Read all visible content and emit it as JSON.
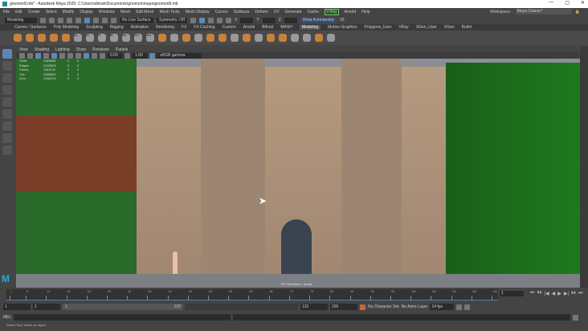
{
  "title": "gnomon8.mb* - Autodesk Maya 2020: C:\\Users\\dimak\\Documents\\gnomon\\maya\\gnomon8.mb",
  "window_controls": [
    "—",
    "▢",
    "✕"
  ],
  "menu": [
    "File",
    "Edit",
    "Create",
    "Select",
    "Modify",
    "Display",
    "Windows",
    "Mesh",
    "Edit Mesh",
    "Mesh Tools",
    "Mesh Display",
    "Curves",
    "Surfaces",
    "Deform",
    "UV",
    "Generate",
    "Cache",
    "V-Ray",
    "Arnold",
    "Help"
  ],
  "workspace": {
    "label": "Workspace :",
    "value": "Maya Classic*"
  },
  "status": {
    "mode": "Modeling",
    "live_surface": "No Live Surface",
    "symmetry": "Symmetry: Off",
    "x_label": "X",
    "y_label": "Y",
    "z_label": "Z",
    "user": "Dima Kremanskiy",
    "notifications": "29"
  },
  "shelf_tabs": [
    "Curves / Surfaces",
    "Poly Modeling",
    "Sculpting",
    "Rigging",
    "Animation",
    "Rendering",
    "FX",
    "FX Caching",
    "Custom",
    "Arnold",
    "Bifrost",
    "MASH",
    "Modeling",
    "Motion Graphics",
    "Polygons_User",
    "VRay",
    "XGen_User",
    "XGen",
    "Bullet"
  ],
  "active_shelf_tab": "Modeling",
  "shelf_labels": [
    "Mirr",
    "CP",
    "FT",
    "BP",
    "MIR",
    "MAT",
    "SUB"
  ],
  "panel_menu": [
    "View",
    "Shading",
    "Lighting",
    "Show",
    "Renderer",
    "Panels"
  ],
  "panel_toolbar": {
    "exposure": "0.00",
    "gamma": "1.00",
    "colorspace": "sRGB gamma"
  },
  "hud": [
    {
      "label": "Verts:",
      "value": "1165609",
      "a": "0",
      "b": "0"
    },
    {
      "label": "Edges:",
      "value": "2343609",
      "a": "0",
      "b": "0"
    },
    {
      "label": "Faces:",
      "value": "1163132",
      "a": "0",
      "b": "0"
    },
    {
      "label": "Tris:",
      "value": "2308903",
      "a": "0",
      "b": "0"
    },
    {
      "label": "UVs:",
      "value": "1282076",
      "a": "0",
      "b": "0"
    }
  ],
  "camera_label": "2D Pan/Zoom : persp",
  "timeline": {
    "ticks": [
      "1",
      "5",
      "10",
      "15",
      "20",
      "25",
      "30",
      "35",
      "40",
      "45",
      "50",
      "55",
      "60",
      "65",
      "70",
      "75",
      "80",
      "85",
      "90",
      "95",
      "100",
      "105",
      "110",
      "115",
      "120"
    ],
    "current_frame": "1"
  },
  "playback_icons": [
    "⏮",
    "⏴⏴",
    "|◀",
    "◀",
    "▶",
    "▶|",
    "⏵⏵",
    "⏭"
  ],
  "range": {
    "start": "1",
    "playback_start": "1",
    "slider_start": "1",
    "slider_end": "120",
    "playback_end": "120",
    "end": "200",
    "character_set": "No Character Set",
    "anim_layer": "No Anim Layer",
    "fps": "24 fps"
  },
  "command": {
    "label": "MEL"
  },
  "help_line": "Select Tool: select an object",
  "watermark": "WORKSHOP",
  "colors": {
    "accent": "#5b87b5",
    "green_wall": "#1f6a1f",
    "brick": "#7a3e28",
    "stone": "#b59a80"
  }
}
